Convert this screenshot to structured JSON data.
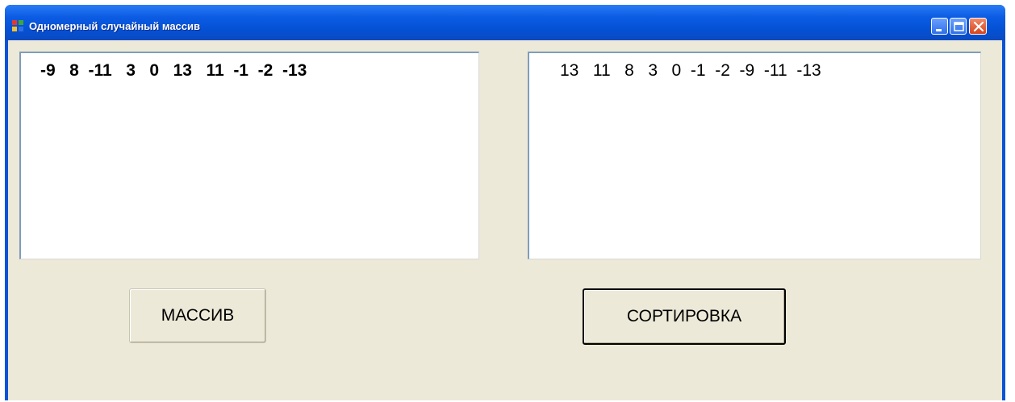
{
  "window": {
    "title": "Одномерный случайный массив",
    "controls": {
      "minimize": "minimize-icon",
      "maximize": "maximize-icon",
      "close": "close-icon"
    }
  },
  "lists": {
    "original": {
      "items": "-9   8  -11   3   0   13   11  -1  -2  -13"
    },
    "sorted": {
      "items": "13   11   8   3   0  -1  -2  -9  -11  -13"
    }
  },
  "buttons": {
    "massiv": "МАССИВ",
    "sort": "СОРТИРОВКА"
  },
  "colors": {
    "titlebar": "#0a53d6",
    "client": "#ece9d8",
    "listbox_border": "#7f9db9"
  }
}
